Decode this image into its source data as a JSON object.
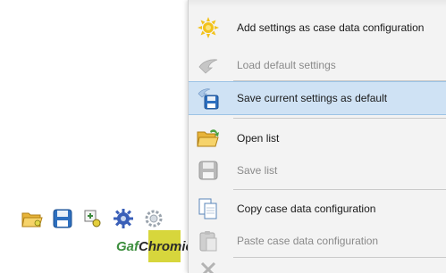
{
  "menu": {
    "items": [
      {
        "label": "Add settings as case data configuration",
        "icon": "sun-settings-icon",
        "disabled": false
      },
      {
        "label": "Load default settings",
        "icon": "arrow-left-icon",
        "disabled": true
      },
      {
        "label": "Save current settings as default",
        "icon": "save-default-icon",
        "disabled": false,
        "highlighted": true
      },
      {
        "label": "Open list",
        "icon": "open-folder-icon",
        "disabled": false
      },
      {
        "label": "Save list",
        "icon": "save-icon",
        "disabled": true
      },
      {
        "label": "Copy case data configuration",
        "icon": "copy-icon",
        "disabled": false
      },
      {
        "label": "Paste case data configuration",
        "icon": "paste-icon",
        "disabled": true
      }
    ]
  },
  "toolbar": {
    "icons": [
      "open-folder-icon",
      "save-icon",
      "add-config-icon",
      "settings-gear-icon",
      "gear-icon"
    ]
  },
  "logo": {
    "part1": "Gaf",
    "part2": "Chromic"
  },
  "colors": {
    "highlight": "#cfe2f4",
    "menu_bg": "#f3f3f3",
    "logo_green": "#3e8f3f",
    "logo_yellow": "#d7d63c"
  }
}
